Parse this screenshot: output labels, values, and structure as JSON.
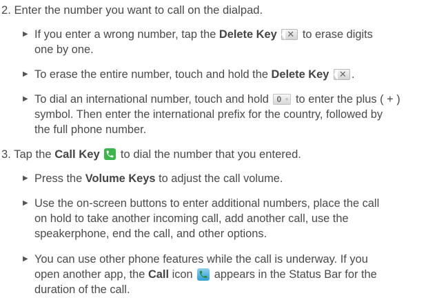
{
  "step2": {
    "number": "2.",
    "text": "Enter the number you want to call on the dialpad.",
    "bullets": [
      {
        "pre": "If you enter a wrong number, tap the ",
        "key": "Delete Key",
        "post_line1": " to erase digits",
        "post_line2": "one by one."
      },
      {
        "pre": "To erase the entire number, touch and hold the ",
        "key": "Delete Key",
        "post": "."
      },
      {
        "pre": "To dial an international number, touch and hold ",
        "post_line1": " to enter the plus ( + )",
        "line2": "symbol. Then enter the international prefix for the country, followed by",
        "line3": "the full phone number."
      }
    ]
  },
  "step3": {
    "number": "3.",
    "pre": "Tap the ",
    "key": "Call Key",
    "post": " to dial the number that you entered.",
    "bullets": [
      {
        "pre": "Press the ",
        "key": "Volume Keys",
        "post": " to adjust the call volume."
      },
      {
        "line1": "Use the on-screen buttons to enter additional numbers, place the call",
        "line2": "on hold to take another incoming call, add another call, use the",
        "line3": "speakerphone, end the call, and other options."
      },
      {
        "line1": "You can use other phone features while the call is underway. If you",
        "line2_pre": "open another app, the ",
        "line2_key": "Call",
        "line2_post": " icon",
        "line2_end": " appears in the Status Bar for the",
        "line3": "duration of the call."
      }
    ]
  },
  "icons": {
    "delete_key": "delete-key-icon",
    "zero_key": "zero-plus-key-icon",
    "zero_label": "0",
    "zero_sub": "+",
    "call_key": "call-key-icon",
    "call_status": "call-status-icon",
    "bullet": "triangle-bullet-icon"
  },
  "colors": {
    "text": "#4a4a4a",
    "call_key": "#3cb54a",
    "call_status": "#2f9fd8"
  }
}
